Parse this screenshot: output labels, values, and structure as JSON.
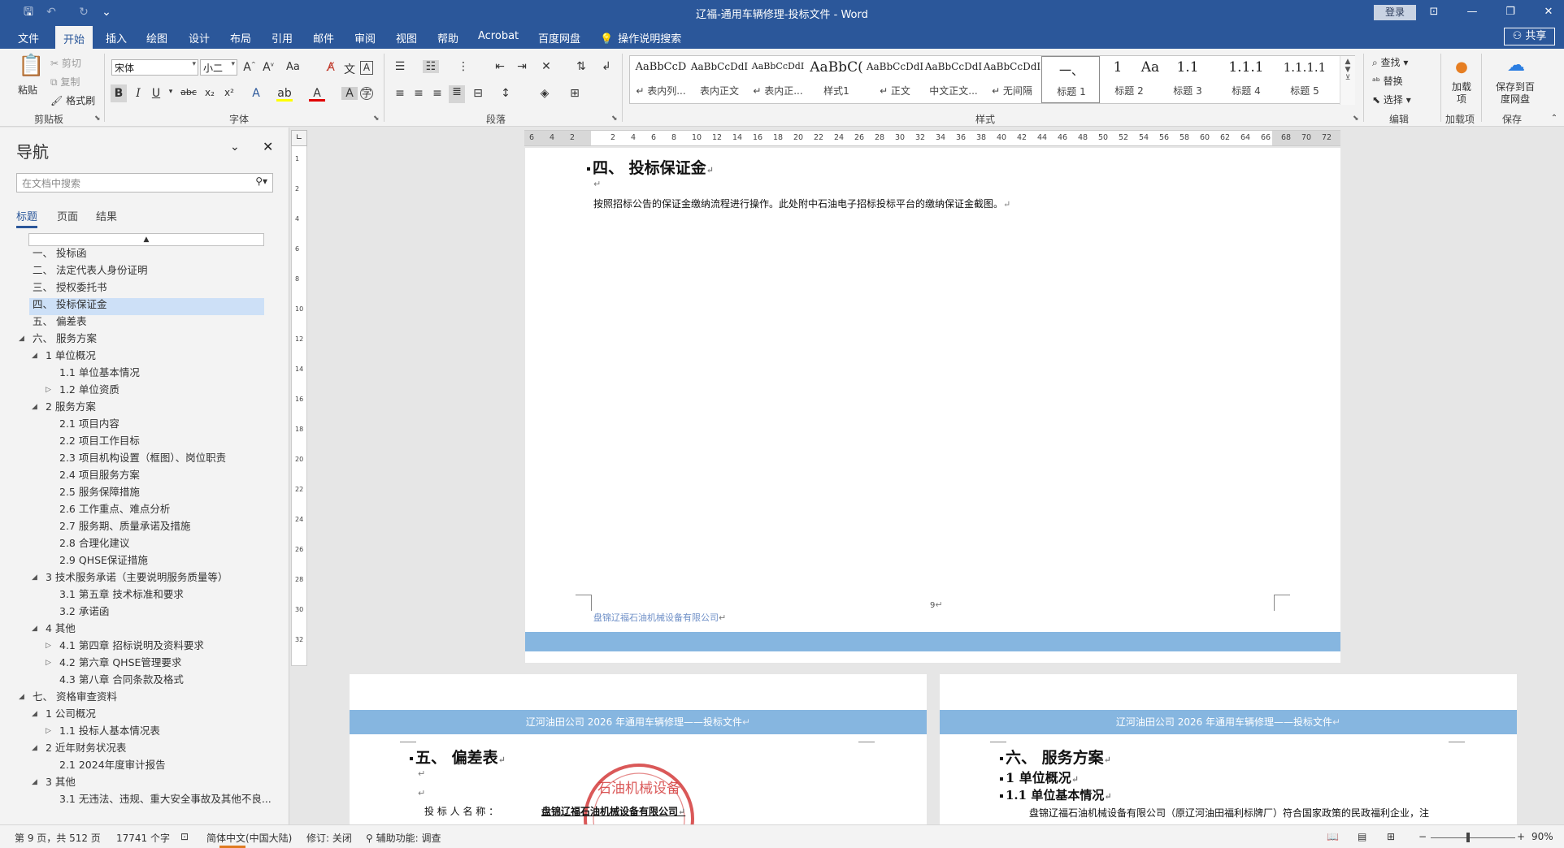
{
  "titlebar": {
    "title": "辽福-通用车辆修理-投标文件 - Word",
    "login": "登录",
    "qa_save": "🖫",
    "qa_undo": "↶",
    "qa_redo": "↻",
    "qa_more": "⌄",
    "win_ribbon_opts": "⊡",
    "win_min": "—",
    "win_restore": "❐",
    "win_close": "✕"
  },
  "tabs": [
    {
      "label": "文件"
    },
    {
      "label": "开始"
    },
    {
      "label": "插入"
    },
    {
      "label": "绘图"
    },
    {
      "label": "设计"
    },
    {
      "label": "布局"
    },
    {
      "label": "引用"
    },
    {
      "label": "邮件"
    },
    {
      "label": "审阅"
    },
    {
      "label": "视图"
    },
    {
      "label": "帮助"
    },
    {
      "label": "Acrobat"
    },
    {
      "label": "百度网盘"
    }
  ],
  "tell_me": "操作说明搜索",
  "share": "共享",
  "ribbon": {
    "clipboard": {
      "paste": "粘贴",
      "cut": "剪切",
      "copy": "复制",
      "format_painter": "格式刷",
      "label": "剪贴板"
    },
    "font": {
      "name": "宋体",
      "size": "小二",
      "label": "字体",
      "case": "Aa"
    },
    "paragraph": {
      "label": "段落"
    },
    "styles": {
      "label": "样式",
      "items": [
        {
          "sample": "AaBbCcD",
          "name": "↵ 表内列..."
        },
        {
          "sample": "AaBbCcDdI",
          "name": "表内正文"
        },
        {
          "sample": "AaBbCcDdI",
          "name": "↵ 表内正..."
        },
        {
          "sample": "AaBbC(",
          "name": "样式1"
        },
        {
          "sample": "AaBbCcDdI",
          "name": "↵ 正文"
        },
        {
          "sample": "AaBbCcDdI",
          "name": "中文正文..."
        },
        {
          "sample": "AaBbCcDdI",
          "name": "↵ 无间隔"
        },
        {
          "sample": "一、",
          "name": "标题 1"
        },
        {
          "sample": "1",
          "name": "标题 2"
        },
        {
          "sample": "Aa",
          "name": "标题 3"
        },
        {
          "sample": "1.1",
          "name": "标题 3"
        },
        {
          "sample": "1.1.1",
          "name": "标题 4"
        },
        {
          "sample": "1.1.1.1",
          "name": "标题 5"
        }
      ]
    },
    "editing": {
      "find": "查找",
      "replace": "替换",
      "select": "选择",
      "label": "编辑"
    },
    "addins": {
      "btn": "加载项",
      "label": "加载项"
    },
    "save": {
      "btn": "保存到百度网盘",
      "label": "保存"
    }
  },
  "nav": {
    "title": "导航",
    "search_placeholder": "在文档中搜索",
    "tabs": [
      "标题",
      "页面",
      "结果"
    ],
    "items": [
      {
        "text": "一、 投标函",
        "level": 0,
        "tri": ""
      },
      {
        "text": "二、 法定代表人身份证明",
        "level": 0,
        "tri": ""
      },
      {
        "text": "三、 授权委托书",
        "level": 0,
        "tri": ""
      },
      {
        "text": "四、 投标保证金",
        "level": 0,
        "tri": ""
      },
      {
        "text": "五、 偏差表",
        "level": 0,
        "tri": ""
      },
      {
        "text": "六、 服务方案",
        "level": 0,
        "tri": "◢"
      },
      {
        "text": "1 单位概况",
        "level": 1,
        "tri": "◢"
      },
      {
        "text": "1.1 单位基本情况",
        "level": 2,
        "tri": ""
      },
      {
        "text": "1.2 单位资质",
        "level": 2,
        "tri": "▷"
      },
      {
        "text": "2 服务方案",
        "level": 1,
        "tri": "◢"
      },
      {
        "text": "2.1 项目内容",
        "level": 2,
        "tri": ""
      },
      {
        "text": "2.2 项目工作目标",
        "level": 2,
        "tri": ""
      },
      {
        "text": "2.3 项目机构设置（框图）、岗位职责",
        "level": 2,
        "tri": ""
      },
      {
        "text": "2.4 项目服务方案",
        "level": 2,
        "tri": ""
      },
      {
        "text": "2.5 服务保障措施",
        "level": 2,
        "tri": ""
      },
      {
        "text": "2.6 工作重点、难点分析",
        "level": 2,
        "tri": ""
      },
      {
        "text": "2.7 服务期、质量承诺及措施",
        "level": 2,
        "tri": ""
      },
      {
        "text": "2.8 合理化建议",
        "level": 2,
        "tri": ""
      },
      {
        "text": "2.9 QHSE保证措施",
        "level": 2,
        "tri": ""
      },
      {
        "text": "3 技术服务承诺（主要说明服务质量等）",
        "level": 1,
        "tri": "◢"
      },
      {
        "text": "3.1 第五章  技术标准和要求",
        "level": 2,
        "tri": ""
      },
      {
        "text": "3.2 承诺函",
        "level": 2,
        "tri": ""
      },
      {
        "text": "4 其他",
        "level": 1,
        "tri": "◢"
      },
      {
        "text": "4.1 第四章  招标说明及资料要求",
        "level": 2,
        "tri": "▷"
      },
      {
        "text": "4.2 第六章  QHSE管理要求",
        "level": 2,
        "tri": "▷"
      },
      {
        "text": "4.3 第八章  合同条款及格式",
        "level": 2,
        "tri": ""
      },
      {
        "text": "七、 资格审查资料",
        "level": 0,
        "tri": "◢"
      },
      {
        "text": "1 公司概况",
        "level": 1,
        "tri": "◢"
      },
      {
        "text": "1.1 投标人基本情况表",
        "level": 2,
        "tri": "▷"
      },
      {
        "text": "2 近年财务状况表",
        "level": 1,
        "tri": "◢"
      },
      {
        "text": "2.1 2024年度审计报告",
        "level": 2,
        "tri": ""
      },
      {
        "text": "3 其他",
        "level": 1,
        "tri": "◢"
      },
      {
        "text": "3.1 无违法、违规、重大安全事故及其他不良...",
        "level": 2,
        "tri": ""
      }
    ]
  },
  "ruler": {
    "h_ticks": [
      "6",
      "4",
      "2",
      "",
      "2",
      "4",
      "6",
      "8",
      "10",
      "12",
      "14",
      "16",
      "18",
      "20",
      "22",
      "24",
      "26",
      "28",
      "30",
      "32",
      "34",
      "36",
      "38",
      "40",
      "42",
      "44",
      "46",
      "48",
      "50",
      "52",
      "54",
      "56",
      "58",
      "60",
      "62",
      "64",
      "66",
      "68",
      "70",
      "72"
    ],
    "v_ticks": [
      "1",
      "2",
      "4",
      "6",
      "8",
      "10",
      "12",
      "14",
      "16",
      "18",
      "20",
      "22",
      "24",
      "26",
      "28",
      "30",
      "32"
    ]
  },
  "page_main": {
    "heading": "四、 投标保证金",
    "body": "按照招标公告的保证金缴纳流程进行操作。此处附中石油电子招标投标平台的缴纳保证金截图。",
    "page_num": "9",
    "footer": "盘锦辽福石油机械设备有限公司"
  },
  "page_left": {
    "header": "辽河油田公司 2026 年通用车辆修理——投标文件",
    "heading": "五、 偏差表",
    "label": "投 标 人 名 称 ：",
    "company": "盘锦辽福石油机械设备有限公司",
    "seal": "盘锦辽福石油机械设备有限公司"
  },
  "page_right": {
    "header": "辽河油田公司 2026 年通用车辆修理——投标文件",
    "h1": "六、 服务方案",
    "h2": "1 单位概况",
    "h3": "1.1 单位基本情况",
    "body": "盘锦辽福石油机械设备有限公司（原辽河油田福利标牌厂）符合国家政策的民政福利企业，注"
  },
  "statusbar": {
    "page": "第 9 页，共 512 页",
    "words": "17741 个字",
    "lang": "简体中文(中国大陆)",
    "track": "修订: 关闭",
    "access": "辅助功能: 调查",
    "zoom": "90%"
  }
}
